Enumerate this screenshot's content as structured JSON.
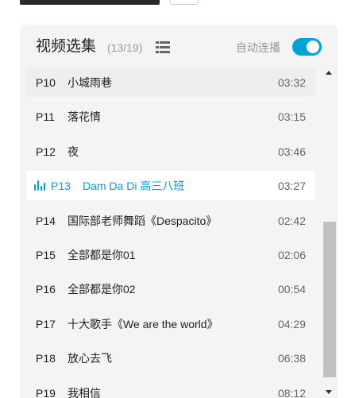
{
  "top": {
    "partial_text": "……"
  },
  "header": {
    "title": "视频选集",
    "count": "(13/19)",
    "list_icon": "list-icon",
    "autoplay_label": "自动连播",
    "autoplay_on": true,
    "accent_color": "#00a1d6"
  },
  "episodes": [
    {
      "p": "P10",
      "name": "小城雨巷",
      "duration": "03:32",
      "state": "hover"
    },
    {
      "p": "P11",
      "name": "落花情",
      "duration": "03:15",
      "state": "normal"
    },
    {
      "p": "P12",
      "name": "夜",
      "duration": "03:46",
      "state": "normal"
    },
    {
      "p": "P13",
      "name": "Dam Da Di 高三八班",
      "duration": "03:27",
      "state": "active"
    },
    {
      "p": "P14",
      "name": "国际部老师舞蹈《Despacito》",
      "duration": "02:42",
      "state": "normal"
    },
    {
      "p": "P15",
      "name": "全部都是你01",
      "duration": "02:06",
      "state": "normal"
    },
    {
      "p": "P16",
      "name": "全部都是你02",
      "duration": "00:54",
      "state": "normal"
    },
    {
      "p": "P17",
      "name": "十大歌手《We are the world》",
      "duration": "04:29",
      "state": "normal"
    },
    {
      "p": "P18",
      "name": "放心去飞",
      "duration": "06:38",
      "state": "normal"
    },
    {
      "p": "P19",
      "name": "我相信",
      "duration": "08:12",
      "state": "normal"
    }
  ]
}
